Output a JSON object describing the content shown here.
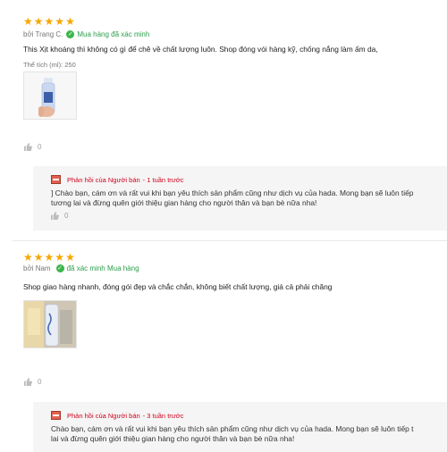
{
  "reviews": [
    {
      "rating": 5,
      "author": "bởi Trang C.",
      "verified": "Mua hàng đã xác minh",
      "content": "This Xịt khoáng thì không có gì để chê về chất lượng luôn. Shop đóng vói hàng kỹ, chống nắng làm ấm da,",
      "attribute": "Thể tích (ml): 250",
      "likes": "0",
      "thumbnail_icon": "product-bottle-photo",
      "reply": {
        "from": "Phản hồi của Người bán",
        "time": "- 1 tuần trước",
        "line1": "] Chào bạn, cám ơn và rất vui khi bạn yêu thích sản phẩm cũng như dịch vụ của hada.  Mong bạn sẽ luôn tiếp",
        "line2": "tương lai và đừng quên giới thiệu gian hàng cho người thân và bạn bè nữa nha!",
        "likes": "0"
      }
    },
    {
      "rating": 5,
      "author": "bởi Nam",
      "verified": "đã xác minh Mua hàng",
      "content": "Shop giao hàng nhanh, đóng gói đẹp và chắc chắn, không biết chất lượng, giá cả phải chăng",
      "likes": "0",
      "thumbnail_icon": "product-bottle-photo",
      "reply": {
        "from": "Phản hồi của Người bán",
        "time": "- 3 tuần trước",
        "line1": "Chào bạn, cám ơn và rất vui khi bạn yêu thích sản phẩm cũng như dịch vụ của hada.  Mong bạn sẽ luôn tiếp t",
        "line2": "lai và đừng quên giới thiệu gian hàng cho người thân và bạn bè nữa nha!",
        "likes": "0"
      }
    }
  ],
  "colors": {
    "star": "#f6a700",
    "verified": "#2a9d4a",
    "seller": "#d0011b",
    "reply_bg": "#f5f5f5"
  }
}
